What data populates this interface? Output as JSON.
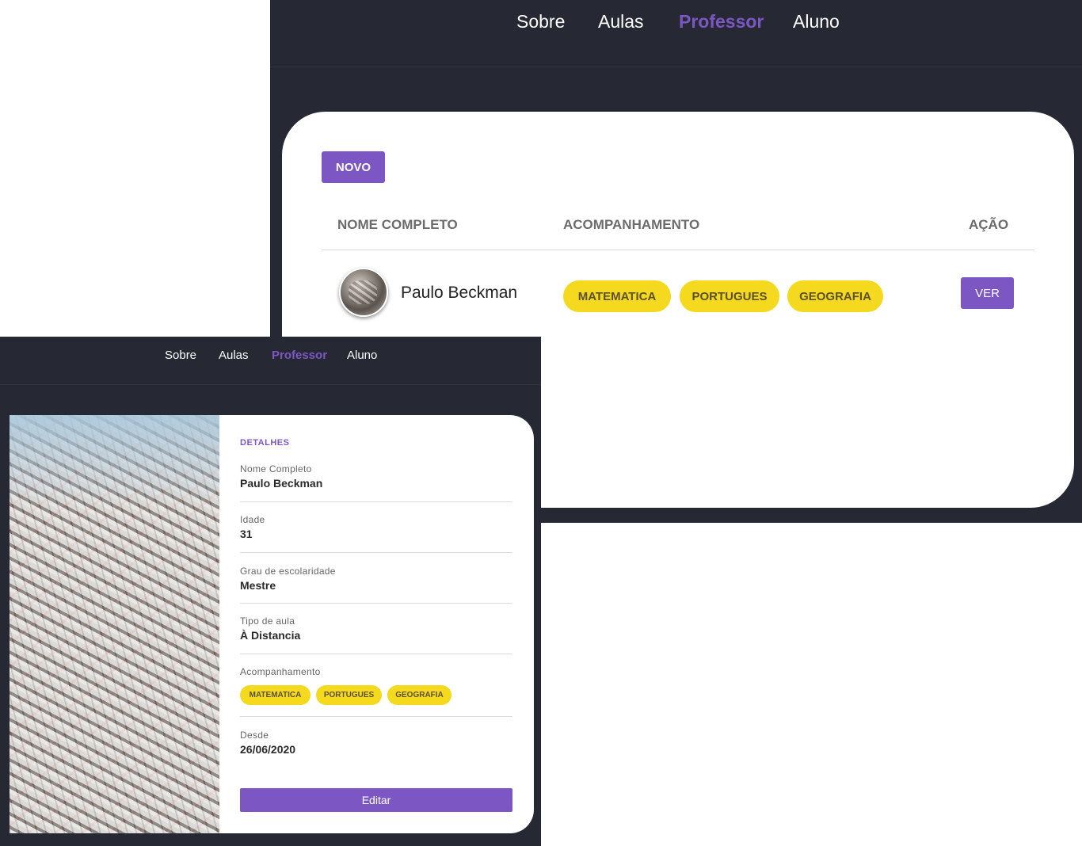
{
  "colors": {
    "navbar_bg": "#262833",
    "accent_purple": "#7c57c4",
    "chip_yellow": "#f5d91e",
    "card_bg": "#ffffff"
  },
  "list_view": {
    "nav": {
      "items": [
        "Sobre",
        "Aulas",
        "Professor",
        "Aluno"
      ],
      "active": "Professor"
    },
    "new_button": "NOVO",
    "table": {
      "headers": [
        "NOME COMPLETO",
        "ACOMPANHAMENTO",
        "AÇÃO"
      ],
      "rows": [
        {
          "name": "Paulo Beckman",
          "subjects": [
            "MATEMATICA",
            "PORTUGUES",
            "GEOGRAFIA"
          ],
          "action": "VER"
        }
      ]
    }
  },
  "detail_view": {
    "nav": {
      "items": [
        "Sobre",
        "Aulas",
        "Professor",
        "Aluno"
      ],
      "active": "Professor"
    },
    "section_title": "DETALHES",
    "fields": [
      {
        "label": "Nome Completo",
        "value": "Paulo Beckman"
      },
      {
        "label": "Idade",
        "value": "31"
      },
      {
        "label": "Grau de escolaridade",
        "value": "Mestre"
      },
      {
        "label": "Tipo de aula",
        "value": "À Distancia"
      }
    ],
    "acompanhamento": {
      "label": "Acompanhamento",
      "subjects": [
        "MATEMATICA",
        "PORTUGUES",
        "GEOGRAFIA"
      ]
    },
    "desde": {
      "label": "Desde",
      "value": "26/06/2020"
    },
    "edit_button": "Editar"
  }
}
